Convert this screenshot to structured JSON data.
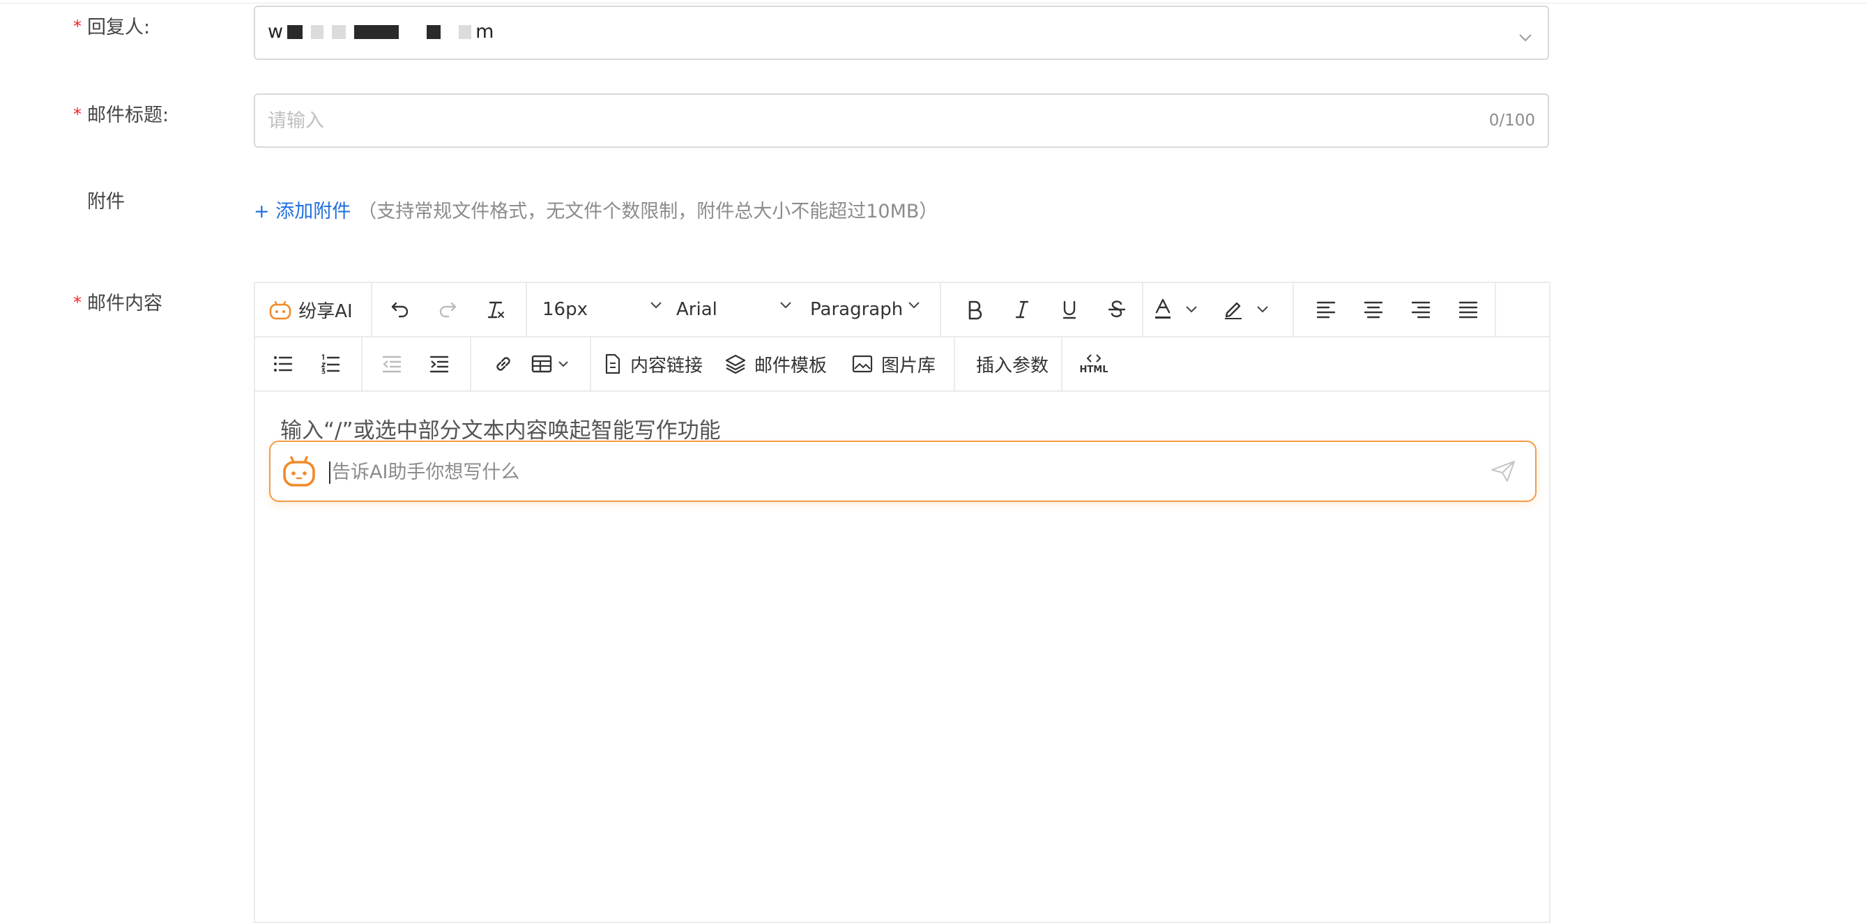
{
  "form": {
    "recipient": {
      "label": "回复人:",
      "value_start": "w",
      "value_end": "m",
      "required_mark": "*"
    },
    "subject": {
      "label": "邮件标题:",
      "placeholder": "请输入",
      "counter": "0/100",
      "required_mark": "*"
    },
    "attachment": {
      "label": "附件",
      "add_label": "+ 添加附件",
      "hint": "（支持常规文件格式，无文件个数限制，附件总大小不能超过10MB）"
    },
    "content": {
      "label": "邮件内容",
      "required_mark": "*"
    }
  },
  "toolbar": {
    "ai_label": "纷享AI",
    "font_size": "16px",
    "font_family": "Arial",
    "block_format": "Paragraph",
    "content_link": "内容链接",
    "mail_template": "邮件模板",
    "image_library": "图片库",
    "insert_params": "插入参数",
    "html_label": "HTML"
  },
  "editor": {
    "hint_text": "输入“/”或选中部分文本内容唤起智能写作功能",
    "ai_prompt_placeholder": "告诉AI助手你想写什么"
  },
  "colors": {
    "accent_blue": "#1f6fe0",
    "ai_orange": "#f39b48",
    "required_red": "#f5222d"
  },
  "icons": [
    "robot-icon",
    "undo-icon",
    "redo-icon",
    "clear-format-icon",
    "chevron-down-icon",
    "bold-icon",
    "italic-icon",
    "underline-icon",
    "strikethrough-icon",
    "font-color-icon",
    "highlight-icon",
    "align-left-icon",
    "align-center-icon",
    "align-right-icon",
    "align-justify-icon",
    "bullet-list-icon",
    "numbered-list-icon",
    "outdent-icon",
    "indent-icon",
    "link-icon",
    "table-icon",
    "content-link-icon",
    "layers-icon",
    "image-icon",
    "code-icon",
    "send-icon"
  ]
}
